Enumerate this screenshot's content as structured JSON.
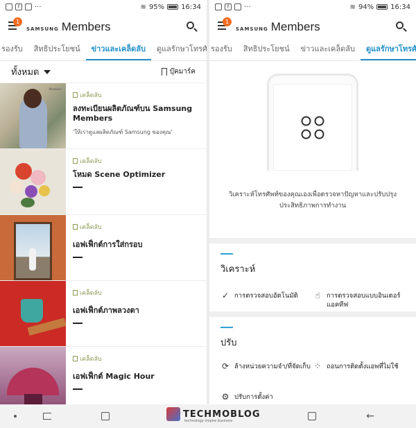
{
  "status_left": {
    "time": "16:34",
    "battery": "95%"
  },
  "status_right": {
    "time": "16:34",
    "battery": "94%"
  },
  "app": {
    "brand": "SAMSUNG",
    "name": "Members",
    "badge": "1"
  },
  "tabs_left": [
    "รองรับ",
    "สิทธิประโยชน์",
    "ข่าวและเคล็ดลับ",
    "ดูแลรักษาโทรศัพท์"
  ],
  "tabs_right": [
    "รองรับ",
    "สิทธิประโยชน์",
    "ข่าวและเคล็ดลับ",
    "ดูแลรักษาโทรศัพท์"
  ],
  "filter": {
    "label": "ทั้งหมด",
    "bookmark": "บุ๊คมาร์ค"
  },
  "articles": [
    {
      "category": "เคล็ดลับ",
      "title": "ลงทะเบียนผลิตภัณฑ์บน Samsung Members",
      "subtitle": "'ให้เราดูแลผลิตภัณฑ์ Samsung ของคุณ'"
    },
    {
      "category": "เคล็ดลับ",
      "title": "โหมด Scene Optimizer",
      "subtitle": ""
    },
    {
      "category": "เคล็ดลับ",
      "title": "เอฟเฟ็กต์การใส่กรอบ",
      "subtitle": ""
    },
    {
      "category": "เคล็ดลับ",
      "title": "เอฟเฟ็กต์ภาพลวงตา",
      "subtitle": ""
    },
    {
      "category": "เคล็ดลับ",
      "title": "เอฟเฟ็กต์ Magic Hour",
      "subtitle": ""
    }
  ],
  "thumb1_tag": "Members",
  "care": {
    "description": "วิเคราะห์โทรศัพท์ของคุณเองเพื่อตรวจหาปัญหาและปรับปรุงประสิทธิภาพการทำงาน",
    "analyze": {
      "title": "วิเคราะห์",
      "actions": [
        "การตรวจสอบอัตโนมัติ",
        "การตรวจสอบแบบอินเตอร์แอคทีฟ"
      ]
    },
    "adjust": {
      "title": "ปรับ",
      "actions": [
        "ล้างหน่วยความจำ/ที่จัดเก็บ",
        "ถอนการติดตั้งแอพที่ไม่ใช้",
        "ปรับการตั้งค่า"
      ]
    }
  },
  "watermark": {
    "name": "TECHMOBLOG",
    "tagline": "technology inspire business"
  }
}
